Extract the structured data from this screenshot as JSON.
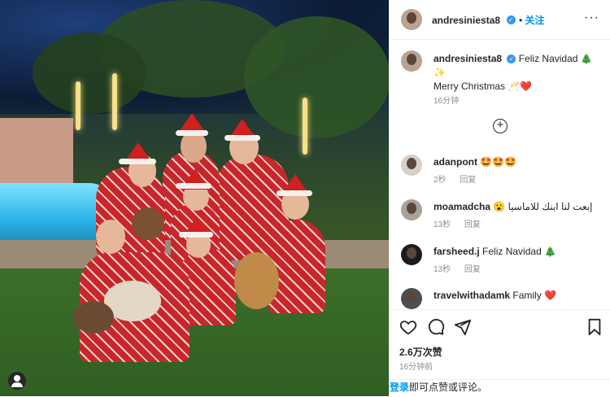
{
  "post": {
    "username": "andresiniesta8",
    "follow_label": "关注",
    "more_label": "···",
    "caption_line1": "Feliz Navidad 🎄",
    "caption_line2": "✨",
    "caption_line3": "Merry Christmas 🥂❤️",
    "caption_time": "16分钟",
    "load_more_label": "+"
  },
  "comments": [
    {
      "username": "adanpont",
      "text": "🤩🤩🤩",
      "time": "2秒",
      "reply": "回复"
    },
    {
      "username": "moamadcha",
      "text": "😮 إبعت لنا ابنك للاماسيا",
      "time": "13秒",
      "reply": "回复"
    },
    {
      "username": "farsheed.j",
      "text": "Feliz Navidad 🎄",
      "time": "13秒",
      "reply": "回复"
    },
    {
      "username": "travelwithadamk",
      "text": "Family ❤️"
    }
  ],
  "actions": {
    "like_icon": "heart-icon",
    "comment_icon": "comment-icon",
    "share_icon": "share-icon",
    "save_icon": "bookmark-icon"
  },
  "stats": {
    "likes": "2.6万次赞",
    "time": "16分钟前"
  },
  "footer": {
    "login": "登录",
    "rest": "即可点赞或评论。"
  },
  "colors": {
    "accent": "#0095f6",
    "heart": "#ed4956",
    "verified": "#3897f0"
  }
}
